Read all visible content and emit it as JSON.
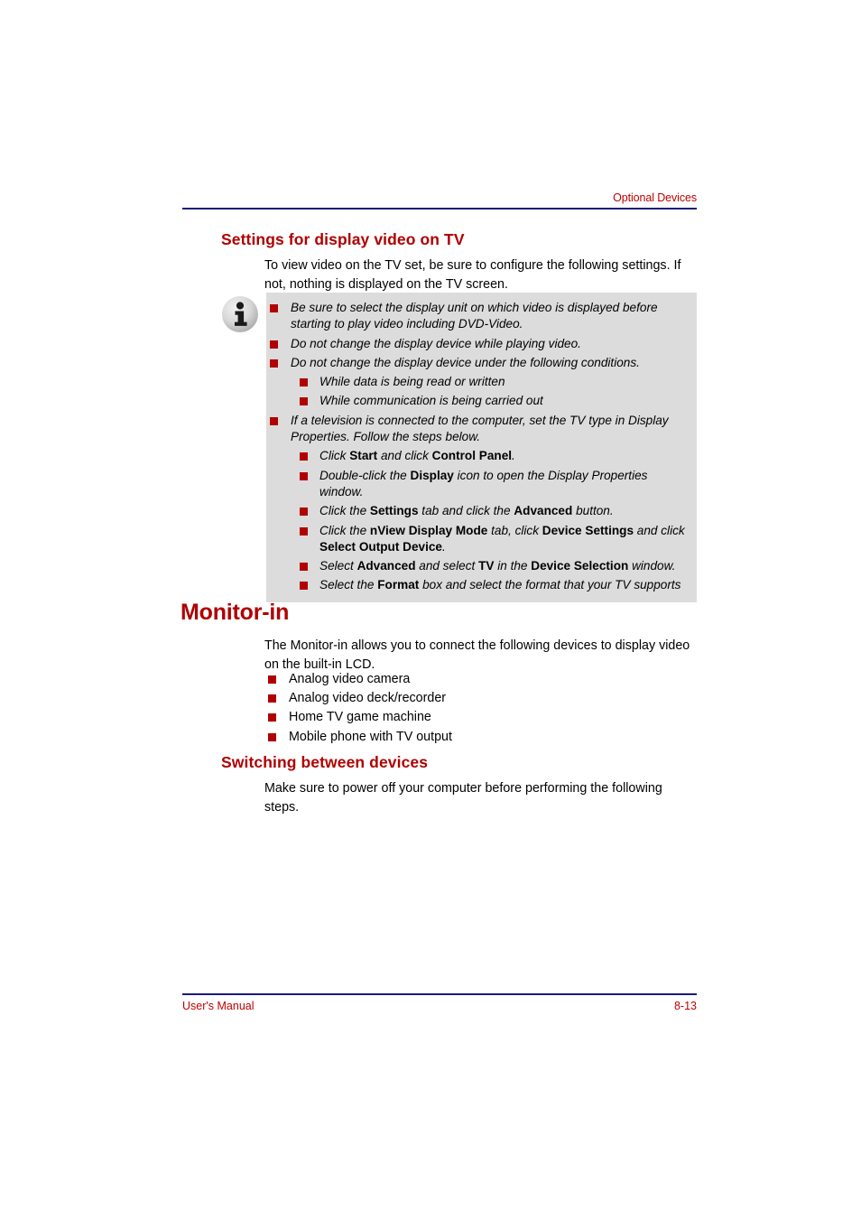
{
  "header": {
    "chapter_title": "Optional Devices"
  },
  "sections": {
    "settings_heading": "Settings for display video on TV",
    "settings_intro": "To view video on the TV set, be sure to configure the following settings. If not, nothing is displayed on the TV screen.",
    "monitor_in_heading": "Monitor-in",
    "monitor_in_intro": "The Monitor-in allows you to connect the following devices to display video on the built-in LCD.",
    "switching_heading": "Switching between devices",
    "switching_intro": "Make sure to power off your computer before performing the following steps."
  },
  "info_box": {
    "icon": "info-icon",
    "items": [
      {
        "level": 1,
        "text": "Be sure to select the display unit on which video is displayed before starting to play video including DVD-Video."
      },
      {
        "level": 1,
        "text": "Do not change the display device while playing video."
      },
      {
        "level": 1,
        "text": "Do not change the display device under the following conditions."
      },
      {
        "level": 2,
        "text": "While data is being read or written"
      },
      {
        "level": 2,
        "text": "While communication is being carried out"
      },
      {
        "level": 1,
        "text": "If a television is connected to the computer, set the TV type in Display Properties. Follow the steps below."
      },
      {
        "level": 2,
        "html": "Click <b>Start</b> and click <b>Control Panel</b>.",
        "text": "Click Start and click Control Panel."
      },
      {
        "level": 2,
        "html": "Double-click the <b>Display</b> icon to open the Display Properties window.",
        "text": "Double-click the Display icon to open the Display Properties window."
      },
      {
        "level": 2,
        "html": "Click the <b>Settings</b> tab and click the <b>Advanced</b> button.",
        "text": "Click the Settings tab and click the Advanced button."
      },
      {
        "level": 2,
        "html": "Click the <b>nView Display Mode</b> tab, click <b>Device Settings</b> and click <b>Select Output Device</b>.",
        "text": "Click the nView Display Mode tab, click Device Settings and click Select Output Device."
      },
      {
        "level": 2,
        "html": "Select <b>Advanced</b> and select <b>TV</b> in the <b>Device Selection</b> window.",
        "text": "Select Advanced and select TV in the Device Selection window."
      },
      {
        "level": 2,
        "html": "Select the <b>Format</b> box and select the format that your TV supports",
        "text": "Select the Format box and select the format that your TV supports"
      }
    ]
  },
  "monitor_in_devices": [
    "Analog video camera",
    "Analog video deck/recorder",
    "Home TV game machine",
    "Mobile phone with TV output"
  ],
  "footer": {
    "manual_label": "User's Manual",
    "page_number": "8-13"
  },
  "colors": {
    "heading_red": "#b00000",
    "header_footer_red": "#c00000",
    "rule_navy": "#1a1a7a",
    "info_box_gray": "#dcdcdc",
    "bullet_red": "#b00000"
  }
}
